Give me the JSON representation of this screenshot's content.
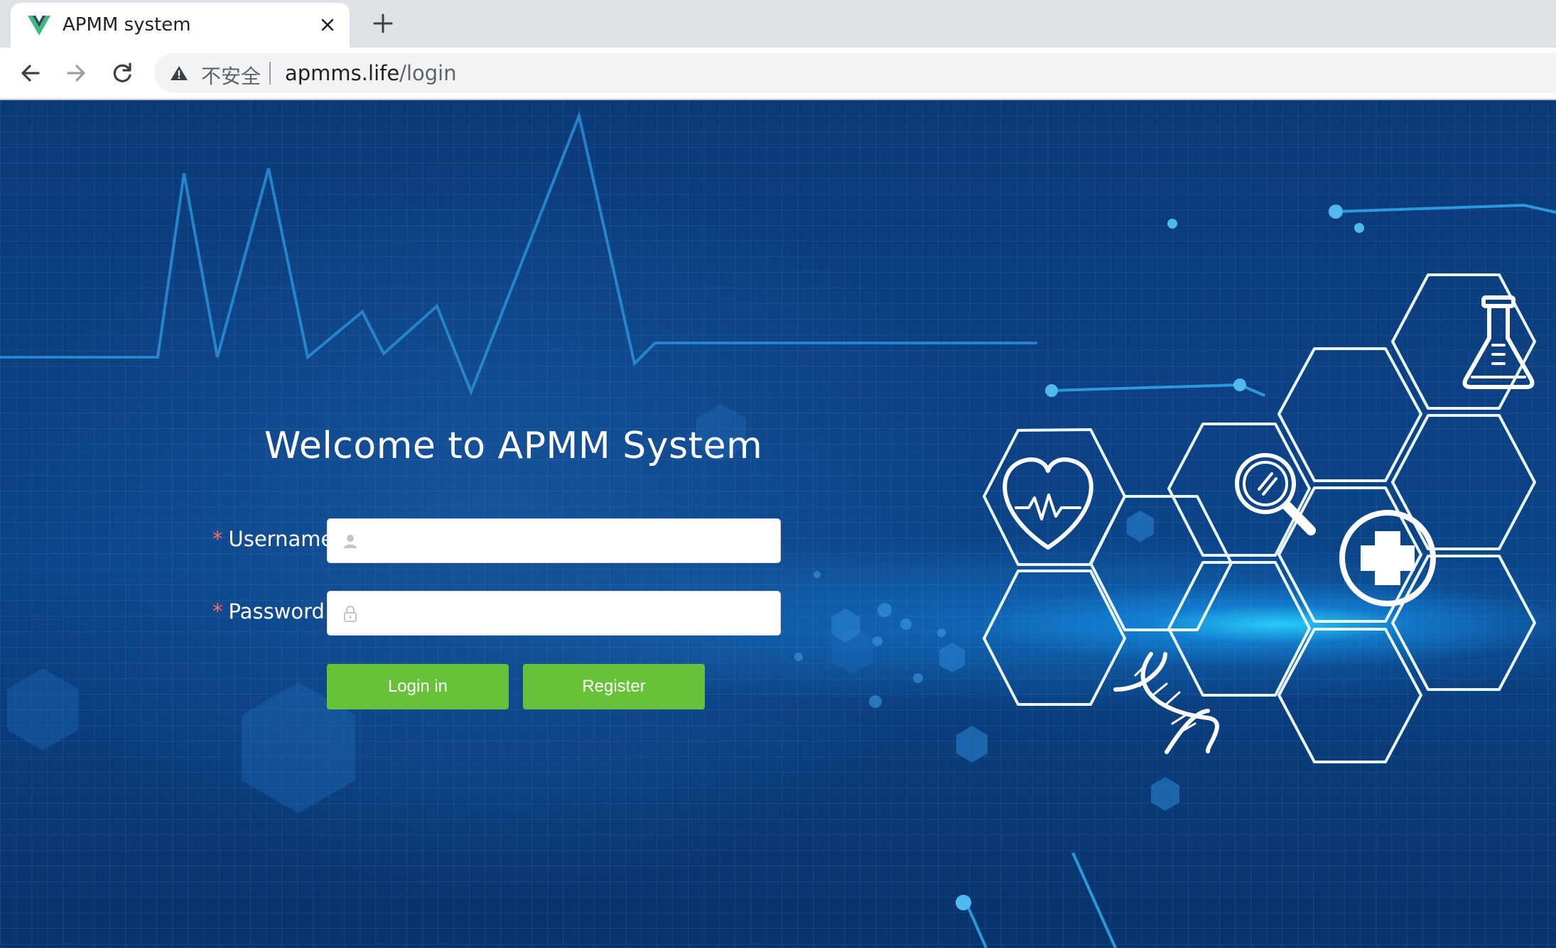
{
  "browser": {
    "tab": {
      "title": "APMM system",
      "favicon": "vue-logo-icon"
    },
    "new_tab_icon": "plus-icon",
    "nav": {
      "back_icon": "arrow-left-icon",
      "forward_icon": "arrow-right-icon",
      "reload_icon": "reload-icon"
    },
    "address": {
      "security_text": "不安全",
      "host": "apmms.life",
      "path": "/login"
    }
  },
  "login": {
    "welcome": "Welcome to APMM System",
    "username": {
      "label": "Username:",
      "required_mark": "*",
      "value": "",
      "placeholder": "",
      "icon": "user-icon"
    },
    "password": {
      "label": "Password:",
      "required_mark": "*",
      "value": "",
      "placeholder": "",
      "icon": "lock-icon"
    },
    "login_button": "Login in",
    "register_button": "Register",
    "button_color": "#67c23a",
    "required_color": "#f56c6c"
  },
  "background": {
    "icons": [
      "heart-pulse-icon",
      "magnifier-icon",
      "flask-icon",
      "medical-cross-icon",
      "dna-icon"
    ]
  }
}
